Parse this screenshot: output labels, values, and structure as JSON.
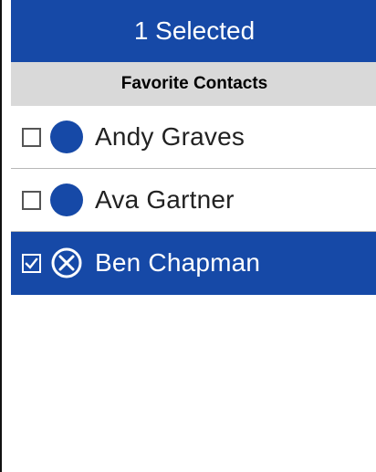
{
  "header": {
    "title": "1 Selected"
  },
  "section": {
    "label": "Favorite Contacts"
  },
  "contacts": [
    {
      "name": "Andy Graves",
      "selected": false
    },
    {
      "name": "Ava Gartner",
      "selected": false
    },
    {
      "name": "Ben Chapman",
      "selected": true
    }
  ],
  "colors": {
    "accent": "#1649a7",
    "section_bg": "#d9d9d9",
    "text": "#222222"
  },
  "icons": {
    "unselected_avatar": "filled-circle",
    "selected_avatar": "circle-x-icon",
    "checkbox_checked": "checkmark-icon"
  }
}
